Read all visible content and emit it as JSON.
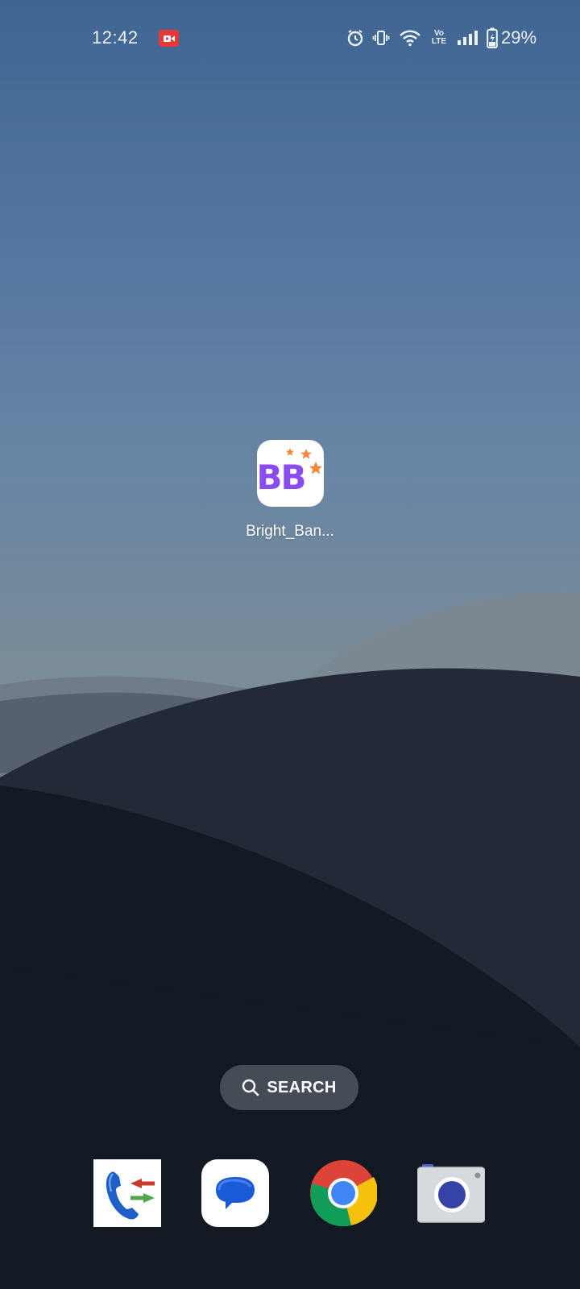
{
  "status_bar": {
    "time": "12:42",
    "battery_percent": "29%",
    "icons": [
      "screen-recording-icon",
      "alarm-icon",
      "vibrate-icon",
      "wifi-icon",
      "volte-icon",
      "signal-icon",
      "battery-charging-icon"
    ],
    "volte_label_top": "Vo",
    "volte_label_bottom": "LTE"
  },
  "home": {
    "apps": [
      {
        "label": "Bright_Ban...",
        "icon_text": "BB",
        "icon": "bright-bank-app-icon"
      }
    ]
  },
  "search": {
    "label": "SEARCH",
    "icon": "search-icon"
  },
  "dock": {
    "apps": [
      {
        "name": "call-forwarding-app",
        "icon": "phone-arrows-icon"
      },
      {
        "name": "messages-app",
        "icon": "chat-bubble-icon"
      },
      {
        "name": "chrome-app",
        "icon": "chrome-icon"
      },
      {
        "name": "camera-app",
        "icon": "camera-icon"
      }
    ]
  },
  "colors": {
    "brand_purple": "#8a4cf0",
    "star_orange": "#f08a3c",
    "record_red": "#e53935"
  }
}
